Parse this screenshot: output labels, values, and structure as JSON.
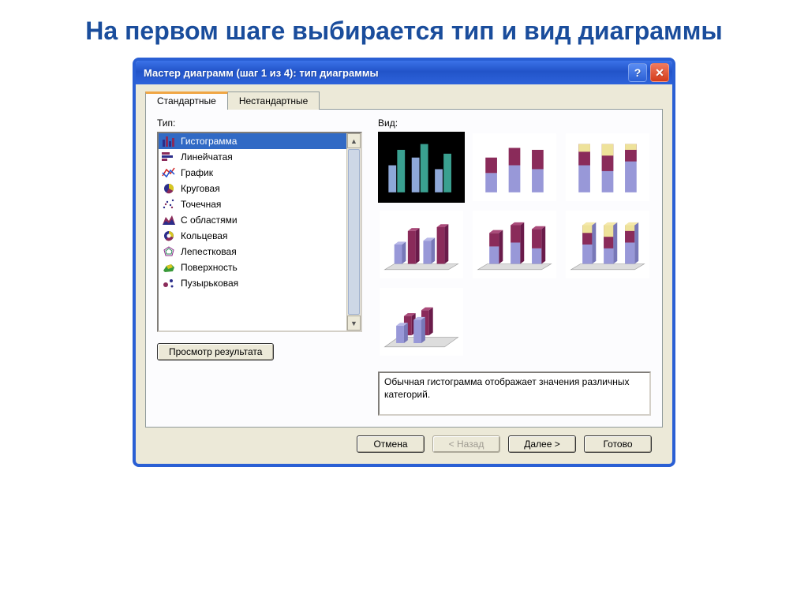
{
  "page": {
    "heading": "На первом шаге выбирается тип и вид диаграммы"
  },
  "dialog": {
    "title": "Мастер диаграмм (шаг 1 из 4): тип диаграммы"
  },
  "tabs": {
    "standard": "Стандартные",
    "nonstandard": "Нестандартные"
  },
  "labels": {
    "type": "Тип:",
    "view": "Вид:"
  },
  "chart_types": [
    {
      "name": "Гистограмма",
      "icon": "bar-icon",
      "selected": true
    },
    {
      "name": "Линейчатая",
      "icon": "hbar-icon"
    },
    {
      "name": "График",
      "icon": "line-icon"
    },
    {
      "name": "Круговая",
      "icon": "pie-icon"
    },
    {
      "name": "Точечная",
      "icon": "scatter-icon"
    },
    {
      "name": "С областями",
      "icon": "area-icon"
    },
    {
      "name": "Кольцевая",
      "icon": "doughnut-icon"
    },
    {
      "name": "Лепестковая",
      "icon": "radar-icon"
    },
    {
      "name": "Поверхность",
      "icon": "surface-icon"
    },
    {
      "name": "Пузырьковая",
      "icon": "bubble-icon"
    }
  ],
  "description": "Обычная гистограмма отображает значения различных категорий.",
  "buttons": {
    "preview": "Просмотр результата",
    "cancel": "Отмена",
    "back": "< Назад",
    "next": "Далее >",
    "finish": "Готово"
  },
  "colors": {
    "titlebar": "#2a5fd4",
    "heading": "#1a4d9c",
    "selection": "#316ac5",
    "dialog_bg": "#ece9d8"
  }
}
